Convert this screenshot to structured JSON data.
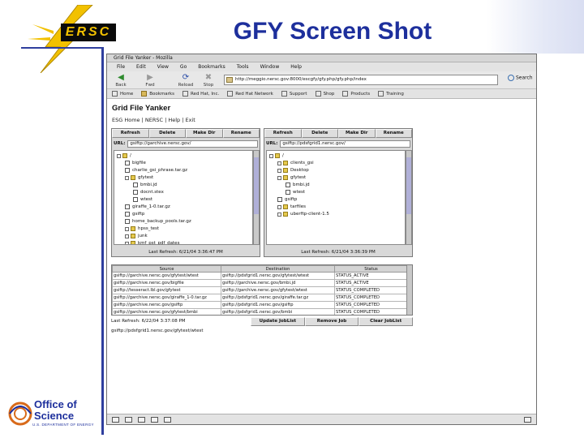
{
  "slide": {
    "title": "GFY Screen Shot",
    "nersc_logo_text": "ERSC",
    "doe_logo_line1": "Office of",
    "doe_logo_line2": "Science",
    "doe_logo_sub": "U.S. DEPARTMENT OF ENERGY"
  },
  "browser": {
    "window_title": "Grid File Yanker - Mozilla",
    "menu": [
      "File",
      "Edit",
      "View",
      "Go",
      "Bookmarks",
      "Tools",
      "Window",
      "Help"
    ],
    "nav": {
      "back": "Back",
      "forward": "Fwd",
      "reload": "Reload",
      "stop": "Stop"
    },
    "url": "http://meggio.nersc.gov:8000/escgfy/gfy.php/gfy.php/index",
    "search_label": "Search",
    "bookmarks": [
      "Home",
      "Bookmarks",
      "Red Hat, Inc.",
      "Red Hat Network",
      "Support",
      "Shop",
      "Products",
      "Training"
    ]
  },
  "app": {
    "heading": "Grid File Yanker",
    "links": "ESG Home | NERSC | Help | Exit",
    "panel_buttons": [
      "Refresh",
      "Delete",
      "Make Dir",
      "Rename"
    ],
    "url_label": "URL:",
    "left_panel": {
      "url": "gsiftp://garchive.nersc.gov/",
      "refreshed": "Last Refresh: 6/21/04 3:36:47 PM",
      "tree": [
        {
          "name": "/",
          "type": "folder",
          "depth": 0
        },
        {
          "name": "bigfile",
          "type": "file",
          "depth": 1
        },
        {
          "name": "charlie_gsi_phrase.tar.gz",
          "type": "file",
          "depth": 1
        },
        {
          "name": "gfytest",
          "type": "folder",
          "depth": 1
        },
        {
          "name": "bmbi.jd",
          "type": "file",
          "depth": 2
        },
        {
          "name": "docnt.stex",
          "type": "file",
          "depth": 2
        },
        {
          "name": "wtest",
          "type": "file",
          "depth": 2
        },
        {
          "name": "giraffe_1-0.tar.gz",
          "type": "file",
          "depth": 1
        },
        {
          "name": "gsiftp",
          "type": "file",
          "depth": 1
        },
        {
          "name": "home_backup_pools.tar.gz",
          "type": "file",
          "depth": 1
        },
        {
          "name": "hpss_test",
          "type": "folder",
          "depth": 1
        },
        {
          "name": "junk",
          "type": "folder",
          "depth": 1
        },
        {
          "name": "kmf_pst_pdf_dates",
          "type": "folder",
          "depth": 1
        }
      ]
    },
    "right_panel": {
      "url": "gsiftp://pdsfgrid1.nersc.gov/",
      "refreshed": "Last Refresh: 6/21/04 3:36:39 PM",
      "tree": [
        {
          "name": "/",
          "type": "folder",
          "depth": 0
        },
        {
          "name": "clients_gsi",
          "type": "folder",
          "depth": 1
        },
        {
          "name": "Desktop",
          "type": "folder",
          "depth": 1
        },
        {
          "name": "gfytest",
          "type": "folder",
          "depth": 1
        },
        {
          "name": "bmbi.jd",
          "type": "file",
          "depth": 2
        },
        {
          "name": "wtest",
          "type": "file",
          "depth": 2
        },
        {
          "name": "gsiftp",
          "type": "file",
          "depth": 1
        },
        {
          "name": "tarfiles",
          "type": "folder",
          "depth": 1
        },
        {
          "name": "uberftp-client-1.5",
          "type": "folder",
          "depth": 1
        }
      ]
    },
    "job_table": {
      "columns": [
        "Source",
        "Destination",
        "Status"
      ],
      "rows": [
        [
          "gsiftp://garchive.nersc.gov/gfytest/wtest",
          "gsiftp://pdsfgrid1.nersc.gov/gfytest/wtest",
          "STATUS_ACTIVE"
        ],
        [
          "gsiftp://garchive.nersc.gov/bigfile",
          "gsiftp://garchive.nersc.gov/bmbi.jd",
          "STATUS_ACTIVE"
        ],
        [
          "gsiftp://tesseract.lbl.gov/gfytest",
          "gsiftp://garchive.nersc.gov/gfytest/wtest",
          "STATUS_COMPLETED"
        ],
        [
          "gsiftp://garchive.nersc.gov/giraffe_1-0.tar.gz",
          "gsiftp://pdsfgrid1.nersc.gov/giraffe.tar.gz",
          "STATUS_COMPLETED"
        ],
        [
          "gsiftp://garchive.nersc.gov/gsiftp",
          "gsiftp://pdsfgrid1.nersc.gov/gsiftp",
          "STATUS_COMPLETED"
        ],
        [
          "gsiftp://garchive.nersc.gov/gfytest/bmbi",
          "gsiftp://pdsfgrid1.nersc.gov/bmbi",
          "STATUS_COMPLETED"
        ]
      ]
    },
    "last_refresh": "Last Refresh: 6/22/04 3:37:08 PM",
    "job_buttons": [
      "Update JobList",
      "Remove Job",
      "Clear JobList"
    ],
    "status_url": "gsiftp://pdsfgrid1.nersc.gov/gfytest/wtest"
  }
}
